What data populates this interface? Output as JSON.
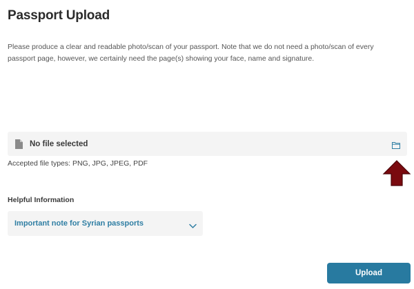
{
  "page": {
    "title": "Passport Upload",
    "description": "Please produce a clear and readable photo/scan of your passport. Note that we do not need a photo/scan of every passport page, however, we certainly need the page(s) showing your face, name and signature."
  },
  "file_input": {
    "status": "No file selected",
    "accepted_types": "Accepted file types: PNG, JPG, JPEG, PDF",
    "icons": {
      "left": "document-icon",
      "right": "folder-icon"
    }
  },
  "helpful_info": {
    "label": "Helpful Information",
    "accordion_label": "Important note for Syrian passports",
    "expand_icon": "chevron-down-icon"
  },
  "actions": {
    "upload_label": "Upload"
  },
  "annotation": {
    "arrow_icon": "up-arrow-icon",
    "arrow_color": "#7a0a0f"
  },
  "colors": {
    "accent": "#287aa0",
    "link": "#2f7ea3",
    "field_background": "#f4f4f4"
  }
}
